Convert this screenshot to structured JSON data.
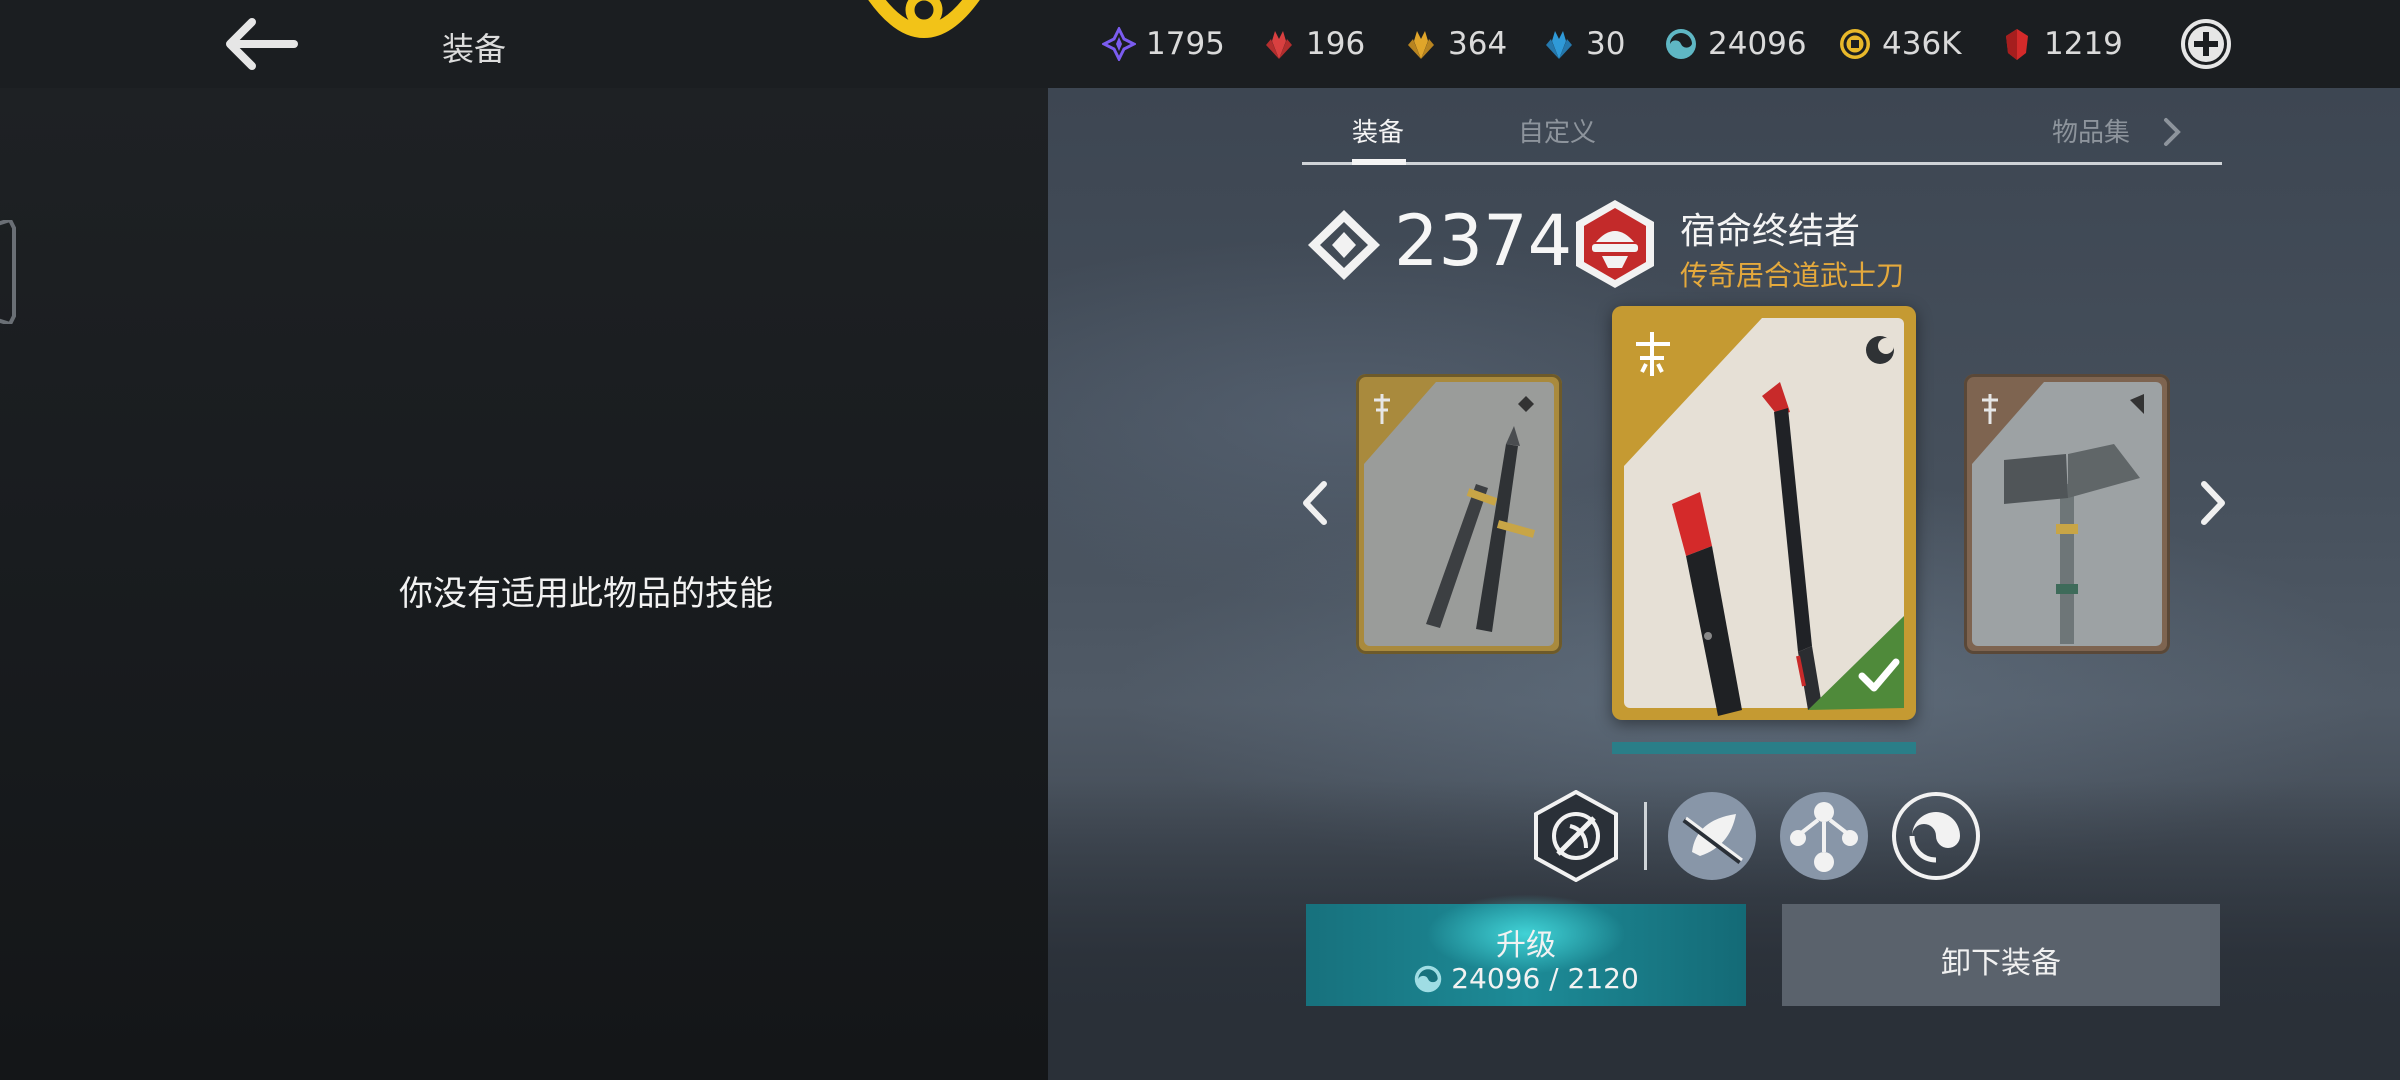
{
  "header": {
    "title": "装备",
    "currencies": [
      {
        "icon": "purple-shard-icon",
        "value": "1795",
        "color": "#7b5cf0"
      },
      {
        "icon": "red-crystal-icon",
        "value": "196",
        "color": "#d94040"
      },
      {
        "icon": "gold-crystal-icon",
        "value": "364",
        "color": "#e0a52a"
      },
      {
        "icon": "blue-crystal-icon",
        "value": "30",
        "color": "#2f9ad8"
      },
      {
        "icon": "energy-swirl-icon",
        "value": "24096",
        "color": "#5fb7c4"
      },
      {
        "icon": "coin-icon",
        "value": "436K",
        "color": "#e8b82a"
      },
      {
        "icon": "ruby-gem-icon",
        "value": "1219",
        "color": "#d42a2a"
      }
    ]
  },
  "left": {
    "message": "你没有适用此物品的技能"
  },
  "tabs": [
    {
      "label": "装备"
    },
    {
      "label": "自定义"
    },
    {
      "label": "物品集"
    }
  ],
  "item": {
    "power": "2374",
    "name": "宿命终结者",
    "type": "传奇居合道武士刀"
  },
  "buttons": {
    "upgrade_label": "升级",
    "upgrade_cost": "24096 / 2120",
    "unequip_label": "卸下装备"
  },
  "colors": {
    "accent_teal": "#1d8b97",
    "legendary_gold": "#c59a32",
    "item_type": "#e5a93c",
    "equipped_green": "#4f8a3a"
  }
}
